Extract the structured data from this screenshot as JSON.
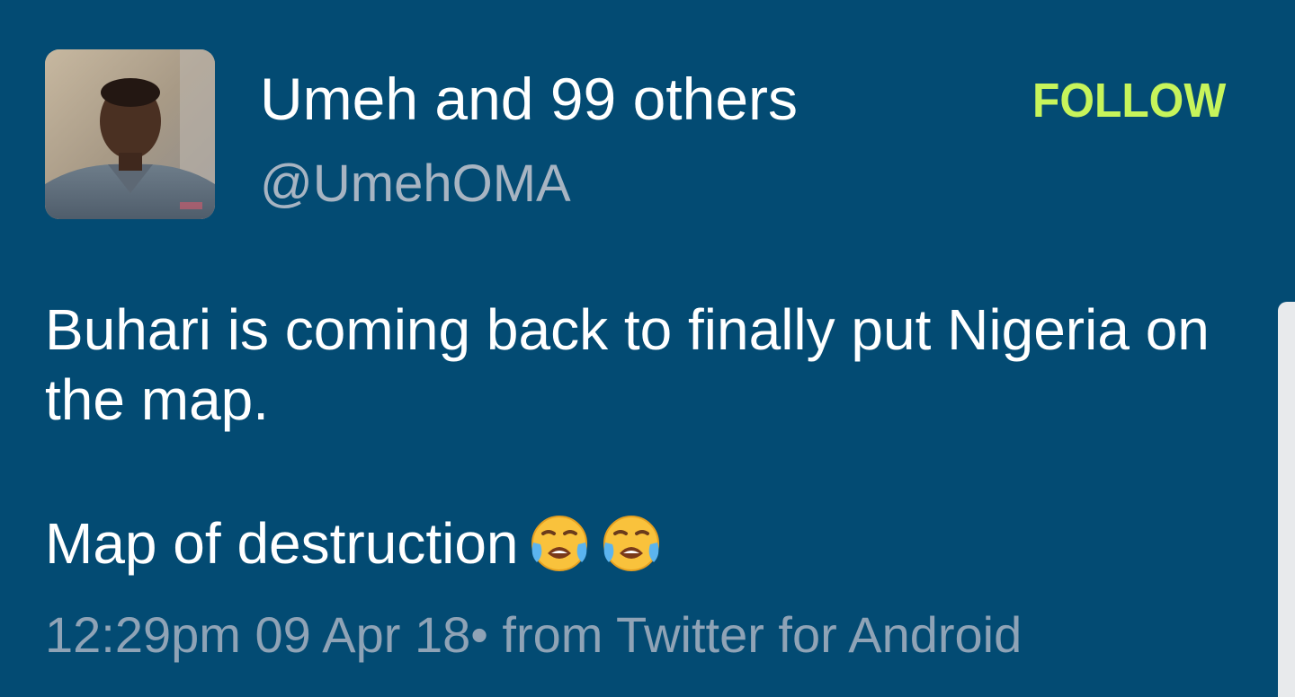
{
  "tweet": {
    "display_name": "Umeh and 99 others",
    "handle": "@UmehOMA",
    "follow_label": "FOLLOW",
    "body_line1": "Buhari is coming back to finally put Nigeria on the map.",
    "body_line2": "Map of destruction",
    "emojis": [
      "loudly-crying-face-icon",
      "loudly-crying-face-icon"
    ],
    "meta": "12:29pm 09 Apr 18• from Twitter for Android"
  },
  "colors": {
    "background": "#034b73",
    "follow_accent": "#c7f45b",
    "text_primary": "#ffffff",
    "text_secondary": "#a7b4c2"
  }
}
